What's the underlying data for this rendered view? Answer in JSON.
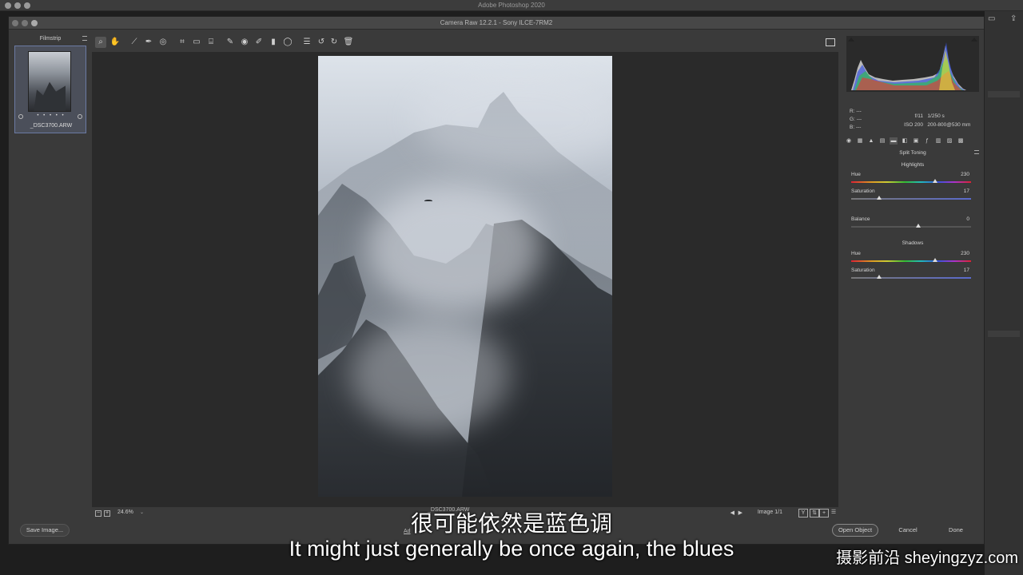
{
  "app": {
    "title": "Adobe Photoshop 2020"
  },
  "dialog": {
    "title": "Camera Raw 12.2.1 - Sony ILCE-7RM2"
  },
  "filmstrip": {
    "title": "Filmstrip",
    "items": [
      {
        "filename": "_DSC3700.ARW",
        "stars": "• • • • •"
      }
    ]
  },
  "toolbar": {
    "tools": [
      {
        "name": "zoom-tool",
        "glyph": "⌕"
      },
      {
        "name": "hand-tool",
        "glyph": "✋"
      },
      {
        "name": "white-balance-tool",
        "glyph": "⟋"
      },
      {
        "name": "color-sampler-tool",
        "glyph": "✒"
      },
      {
        "name": "targeted-adjustment-tool",
        "glyph": "◎"
      },
      {
        "name": "crop-tool",
        "glyph": "⌗"
      },
      {
        "name": "straighten-tool",
        "glyph": "▭"
      },
      {
        "name": "transform-tool",
        "glyph": "⌸"
      },
      {
        "name": "spot-removal-tool",
        "glyph": "✎"
      },
      {
        "name": "red-eye-tool",
        "glyph": "◉"
      },
      {
        "name": "adjustment-brush-tool",
        "glyph": "✐"
      },
      {
        "name": "graduated-filter-tool",
        "glyph": "▮"
      },
      {
        "name": "radial-filter-tool",
        "glyph": "◯"
      },
      {
        "name": "preferences-tool",
        "glyph": "☰"
      },
      {
        "name": "rotate-left-tool",
        "glyph": "↺"
      },
      {
        "name": "rotate-right-tool",
        "glyph": "↻"
      },
      {
        "name": "delete-tool",
        "glyph": "🗑"
      }
    ]
  },
  "status": {
    "zoom": "24.6%",
    "filename": "_DSC3700.ARW",
    "image_counter": "Image 1/1",
    "y_label": "Y"
  },
  "info": {
    "r_label": "R:",
    "r_value": "---",
    "g_label": "G:",
    "g_value": "---",
    "b_label": "B:",
    "b_value": "---",
    "aperture": "f/11",
    "shutter": "1/250 s",
    "iso": "ISO 200",
    "lens": "200-800@530 mm"
  },
  "panel": {
    "title": "Split Toning",
    "highlights_title": "Highlights",
    "shadows_title": "Shadows",
    "highlights": {
      "hue_label": "Hue",
      "hue_value": "230",
      "sat_label": "Saturation",
      "sat_value": "17"
    },
    "balance": {
      "label": "Balance",
      "value": "0"
    },
    "shadows": {
      "hue_label": "Hue",
      "hue_value": "230",
      "sat_label": "Saturation",
      "sat_value": "17"
    }
  },
  "buttons": {
    "save_image": "Save Image...",
    "open_object": "Open Object",
    "cancel": "Cancel",
    "done": "Done",
    "workflow": "Ad"
  },
  "subtitles": {
    "chinese": "很可能依然是蓝色调",
    "english": "It might just generally be once again, the blues"
  },
  "watermark": "摄影前沿 sheyingzyz.com"
}
